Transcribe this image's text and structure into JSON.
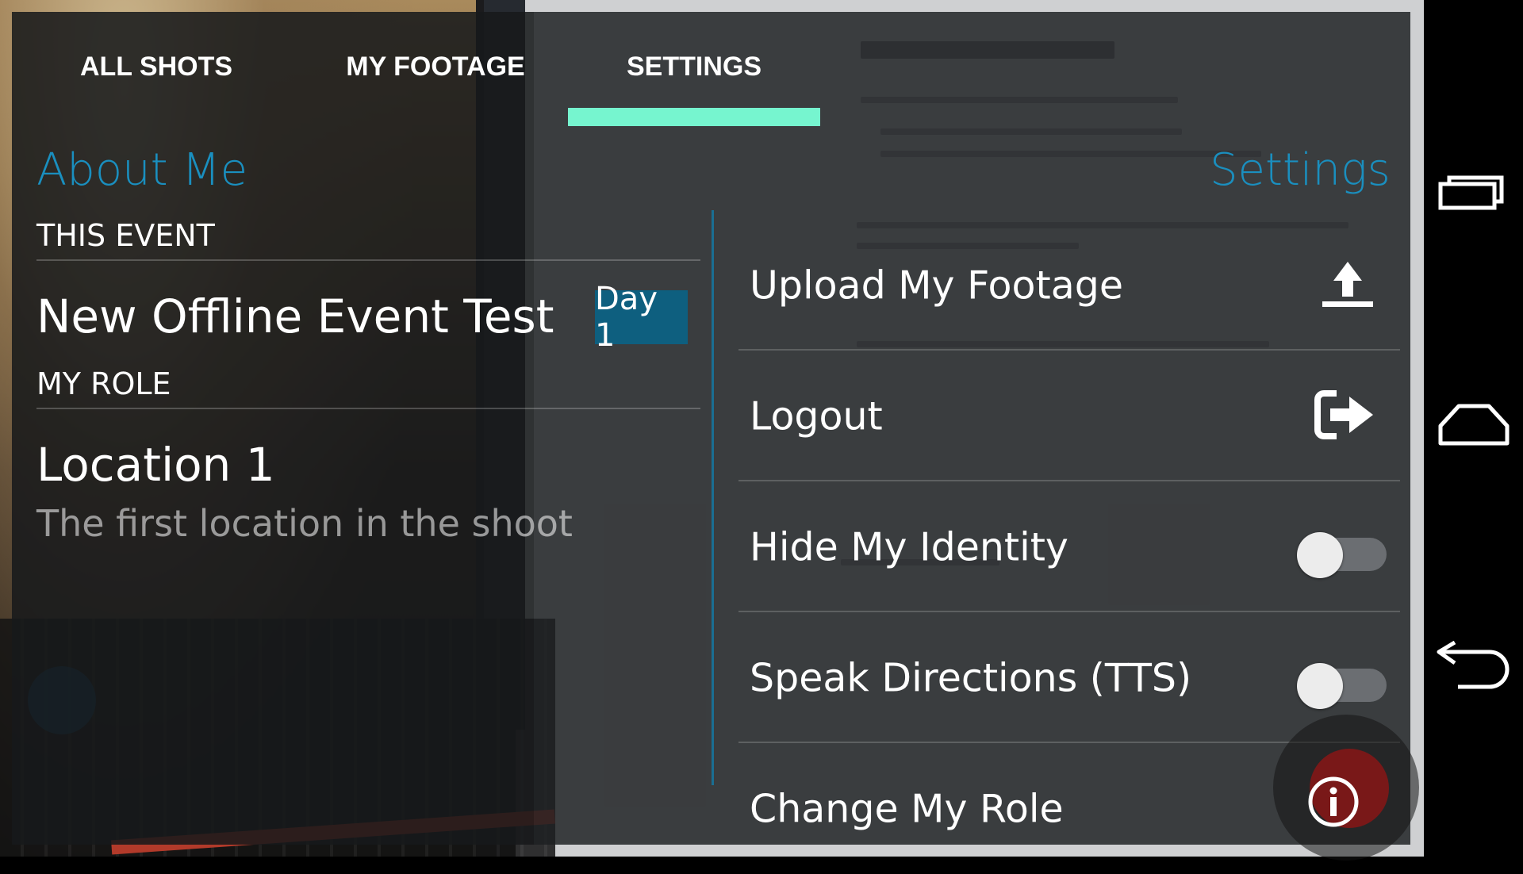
{
  "tabs": [
    {
      "label": "ALL SHOTS",
      "active": false
    },
    {
      "label": "MY FOOTAGE",
      "active": false
    },
    {
      "label": "SETTINGS",
      "active": true
    }
  ],
  "about": {
    "title": "About Me",
    "this_event_header": "THIS EVENT",
    "event_name": "New Offline Event Test",
    "day_badge": "Day 1",
    "my_role_header": "MY ROLE",
    "role_name": "Location 1",
    "role_description": "The first location in the shoot"
  },
  "settings": {
    "title": "Settings",
    "items": [
      {
        "label": "Upload My Footage",
        "icon": "upload-icon"
      },
      {
        "label": "Logout",
        "icon": "logout-icon"
      },
      {
        "label": "Hide My Identity",
        "toggle": false
      },
      {
        "label": "Speak Directions (TTS)",
        "toggle": false
      },
      {
        "label": "Change My Role",
        "icon": "info-icon"
      }
    ]
  },
  "navbar": {
    "buttons": [
      "recent-apps-icon",
      "home-icon",
      "back-icon"
    ]
  },
  "colors": {
    "accent_teal": "#76f5cf",
    "title_blue": "#1a8fbf",
    "badge_blue": "#0e5f7f",
    "divider_blue": "#1a6f93"
  }
}
